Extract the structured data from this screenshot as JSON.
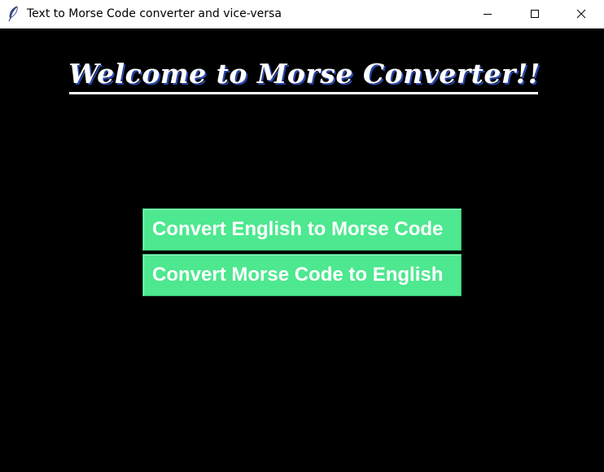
{
  "window": {
    "title": "Text to Morse Code converter and vice-versa",
    "app_icon": "feather-icon",
    "controls": {
      "minimize_icon": "minimize-icon",
      "maximize_icon": "maximize-icon",
      "close_icon": "close-icon"
    }
  },
  "main": {
    "heading": "Welcome to Morse Converter!!",
    "buttons": [
      {
        "label": "Convert English to Morse Code"
      },
      {
        "label": "Convert Morse Code to English"
      }
    ]
  },
  "colors": {
    "background": "#000000",
    "button": "#4de88f",
    "button_text": "#ffffff",
    "heading": "#ffffff",
    "heading_shadow": "#2a46a8"
  }
}
